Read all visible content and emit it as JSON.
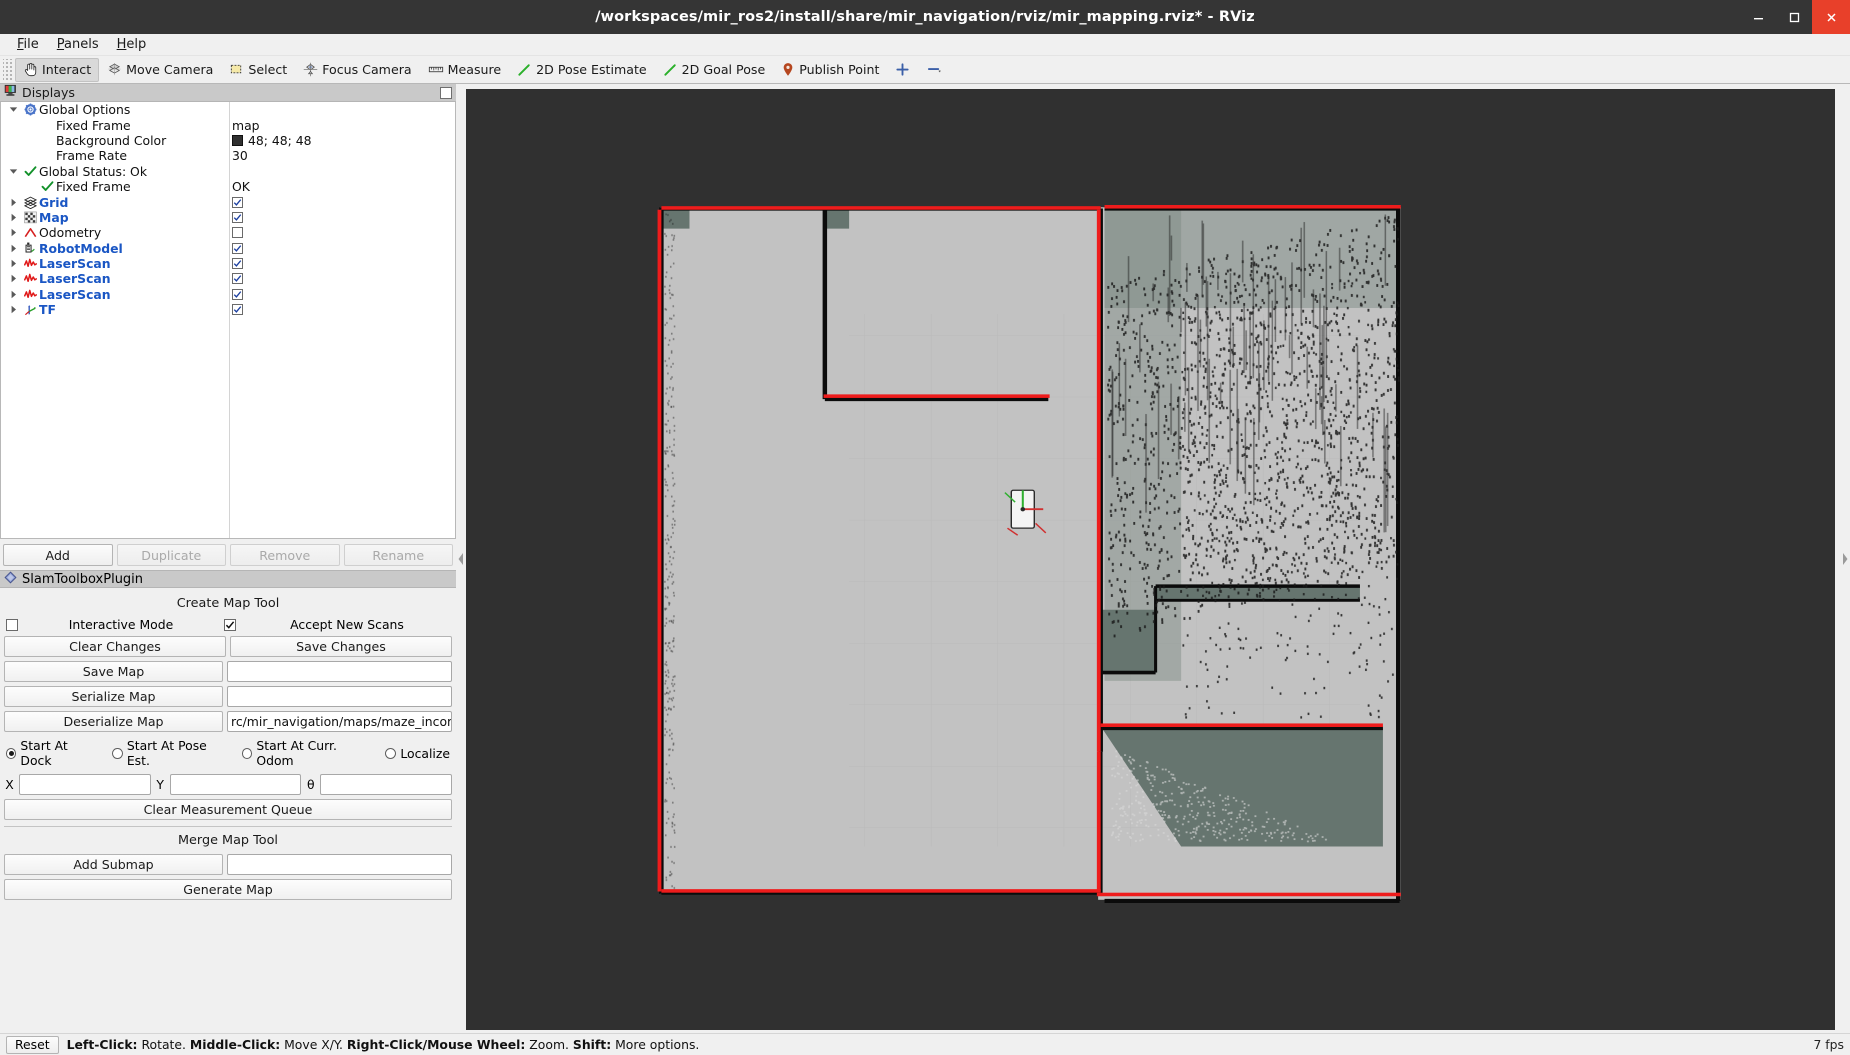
{
  "window": {
    "title": "/workspaces/mir_ros2/install/share/mir_navigation/rviz/mir_mapping.rviz* - RViz",
    "minimize_label": "minimize-icon",
    "maximize_label": "maximize-icon",
    "close_label": "close-icon"
  },
  "menubar": {
    "items": [
      {
        "label": "File"
      },
      {
        "label": "Panels"
      },
      {
        "label": "Help"
      }
    ]
  },
  "toolbar": {
    "items": [
      {
        "label": "Interact",
        "icon": "hand-cursor-icon",
        "active": true
      },
      {
        "label": "Move Camera",
        "icon": "move-camera-icon",
        "active": false
      },
      {
        "label": "Select",
        "icon": "select-rect-icon",
        "active": false
      },
      {
        "label": "Focus Camera",
        "icon": "focus-camera-icon",
        "active": false
      },
      {
        "label": "Measure",
        "icon": "ruler-icon",
        "active": false
      },
      {
        "label": "2D Pose Estimate",
        "icon": "pose-arrow-green-icon",
        "active": false
      },
      {
        "label": "2D Goal Pose",
        "icon": "goal-arrow-green-icon",
        "active": false
      },
      {
        "label": "Publish Point",
        "icon": "map-pin-icon",
        "active": false
      }
    ],
    "extra": [
      {
        "icon": "add-tool-plus-icon"
      },
      {
        "icon": "remove-tool-minus-icon"
      }
    ]
  },
  "displays_panel": {
    "title": "Displays",
    "icon": "displays-monitor-icon",
    "float_button": "float-panel-button",
    "rows": [
      {
        "indent": 0,
        "arrow": "down",
        "icon": "gear-icon",
        "label": "Global Options",
        "bold": false,
        "value_type": "none",
        "value": ""
      },
      {
        "indent": 1,
        "arrow": "none",
        "icon": "none",
        "label": "Fixed Frame",
        "bold": false,
        "value_type": "text",
        "value": "map"
      },
      {
        "indent": 1,
        "arrow": "none",
        "icon": "none",
        "label": "Background Color",
        "bold": false,
        "value_type": "color",
        "value": "48; 48; 48",
        "color": "#303030"
      },
      {
        "indent": 1,
        "arrow": "none",
        "icon": "none",
        "label": "Frame Rate",
        "bold": false,
        "value_type": "text",
        "value": "30"
      },
      {
        "indent": 0,
        "arrow": "down",
        "icon": "check-icon",
        "label": "Global Status: Ok",
        "bold": false,
        "value_type": "none",
        "value": ""
      },
      {
        "indent": 1,
        "arrow": "none",
        "icon": "check-icon",
        "label": "Fixed Frame",
        "bold": false,
        "value_type": "text",
        "value": "OK"
      },
      {
        "indent": 0,
        "arrow": "right",
        "icon": "grid-icon",
        "label": "Grid",
        "bold": true,
        "value_type": "checkbox",
        "value": "checked"
      },
      {
        "indent": 0,
        "arrow": "right",
        "icon": "map-icon",
        "label": "Map",
        "bold": true,
        "value_type": "checkbox",
        "value": "checked"
      },
      {
        "indent": 0,
        "arrow": "right",
        "icon": "odometry-icon",
        "label": "Odometry",
        "bold": false,
        "value_type": "checkbox",
        "value": "unchecked"
      },
      {
        "indent": 0,
        "arrow": "right",
        "icon": "robotmodel-icon",
        "label": "RobotModel",
        "bold": true,
        "value_type": "checkbox",
        "value": "checked"
      },
      {
        "indent": 0,
        "arrow": "right",
        "icon": "laserscan-icon",
        "label": "LaserScan",
        "bold": true,
        "value_type": "checkbox",
        "value": "checked"
      },
      {
        "indent": 0,
        "arrow": "right",
        "icon": "laserscan-icon",
        "label": "LaserScan",
        "bold": true,
        "value_type": "checkbox",
        "value": "checked"
      },
      {
        "indent": 0,
        "arrow": "right",
        "icon": "laserscan-icon",
        "label": "LaserScan",
        "bold": true,
        "value_type": "checkbox",
        "value": "checked"
      },
      {
        "indent": 0,
        "arrow": "right",
        "icon": "tf-icon",
        "label": "TF",
        "bold": true,
        "value_type": "checkbox",
        "value": "checked"
      }
    ],
    "buttons": [
      {
        "label": "Add",
        "enabled": true
      },
      {
        "label": "Duplicate",
        "enabled": false
      },
      {
        "label": "Remove",
        "enabled": false
      },
      {
        "label": "Rename",
        "enabled": false
      }
    ]
  },
  "slam_panel": {
    "title": "SlamToolboxPlugin",
    "icon": "slam-diamond-icon",
    "float_button": "float-panel-button",
    "create_map_tool_label": "Create Map Tool",
    "interactive_mode_label": "Interactive Mode",
    "interactive_mode_checked": true,
    "accept_new_scans_label": "Accept New Scans",
    "accept_new_scans_checked": false,
    "clear_changes_label": "Clear Changes",
    "save_changes_label": "Save Changes",
    "save_map_label": "Save Map",
    "save_map_value": "",
    "serialize_map_label": "Serialize Map",
    "serialize_map_value": "",
    "deserialize_map_label": "Deserialize Map",
    "deserialize_map_value": "rc/mir_navigation/maps/maze_incomplete",
    "start_modes": [
      {
        "label": "Start At Dock",
        "selected": true
      },
      {
        "label": "Start At Pose Est.",
        "selected": false
      },
      {
        "label": "Start At Curr. Odom",
        "selected": false
      },
      {
        "label": "Localize",
        "selected": false
      }
    ],
    "x_label": "X",
    "x_value": "",
    "y_label": "Y",
    "y_value": "",
    "theta_label": "θ",
    "theta_value": "",
    "clear_measurement_queue_label": "Clear Measurement Queue",
    "merge_map_tool_label": "Merge Map Tool",
    "add_submap_label": "Add Submap",
    "add_submap_value": "",
    "generate_map_label": "Generate Map"
  },
  "render_view": {
    "background_color": "#303030",
    "map_free_color": "#c0c0c0",
    "map_occupied_color": "#0a0a0a",
    "map_shadow_color": "#5f6f6a",
    "scan_color": "#ee1c1c",
    "grid_color": "#9a9a9a",
    "robot_color": "#f2f2f2"
  },
  "statusbar": {
    "reset_label": "Reset",
    "hints": [
      {
        "bold": "Left-Click:",
        "text": " Rotate. "
      },
      {
        "bold": "Middle-Click:",
        "text": " Move X/Y. "
      },
      {
        "bold": "Right-Click/Mouse Wheel:",
        "text": " Zoom. "
      },
      {
        "bold": "Shift:",
        "text": " More options."
      }
    ],
    "fps": "7 fps"
  }
}
